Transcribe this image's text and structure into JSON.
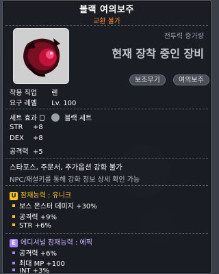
{
  "item": {
    "name": "블랙 여의보주",
    "trade_status": "교환 불가"
  },
  "combat_power": {
    "label": "전투력 증가량",
    "value": "현재 장착 중인 장비"
  },
  "tags": [
    "보조무기",
    "여의보주"
  ],
  "requirements": {
    "job_label": "착용 직업",
    "job_value": "렌",
    "level_label": "요구 레벨",
    "level_value": "Lv. 100"
  },
  "set_effect": {
    "label": "세트 효과",
    "value": "블랙 세트"
  },
  "stats": [
    {
      "name": "STR",
      "value": "+8"
    },
    {
      "name": "DEX",
      "value": "+8"
    },
    {
      "name": "공격력",
      "value": "+5"
    }
  ],
  "notes": {
    "enhance_disabled": "스타포스, 주문서, 추가옵션 강화 불가",
    "npc_hint": "NPC/재설키를 통해 강화 정보 상세 확인 가능"
  },
  "potential": {
    "label": "잠재능력 : 유니크",
    "lines": [
      "보스 몬스터 데미지 +30%",
      "공격력 +9%",
      "STR +6%"
    ],
    "color": "#ffc21a"
  },
  "additional_potential": {
    "label": "에디셔널 잠재능력 : 에픽",
    "lines": [
      "공격력 +6%",
      "최대 MP +100",
      "INT +3%"
    ],
    "color": "#a884ff"
  },
  "icons": [
    "lock-icon",
    "set-preview-icon",
    "unique-grade-icon",
    "epic-grade-icon"
  ]
}
